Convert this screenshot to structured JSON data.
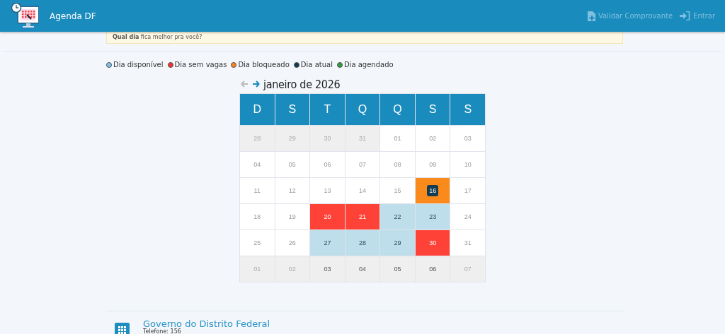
{
  "header": {
    "app_name": "Agenda DF",
    "actions": [
      {
        "label": "Validar Comprovante",
        "kind": "document"
      },
      {
        "label": "Entrar",
        "kind": "login"
      }
    ]
  },
  "notice": {
    "text": "**Qual dia** fica melhor pra você?"
  },
  "legend": [
    {
      "label": "Dia disponível",
      "color": "#7fc3e4"
    },
    {
      "label": "Dia sem vagas",
      "color": "#f0332f"
    },
    {
      "label": "Dia bloqueado",
      "color": "#f7861b"
    },
    {
      "label": "Dia atual",
      "color": "#123c52"
    },
    {
      "label": "Dia agendado",
      "color": "#2e9e3c"
    }
  ],
  "calendar": {
    "title": "janeiro de 2026",
    "prev_disabled": true,
    "next_disabled": false,
    "weekdays": [
      "D",
      "S",
      "T",
      "Q",
      "Q",
      "S",
      "S"
    ],
    "weeks": [
      [
        {
          "day": "28",
          "kind": "outside"
        },
        {
          "day": "29",
          "kind": "outside"
        },
        {
          "day": "30",
          "kind": "outside"
        },
        {
          "day": "31",
          "kind": "outside"
        },
        {
          "day": "01",
          "kind": "normal"
        },
        {
          "day": "02",
          "kind": "normal"
        },
        {
          "day": "03",
          "kind": "normal"
        }
      ],
      [
        {
          "day": "04",
          "kind": "normal"
        },
        {
          "day": "05",
          "kind": "normal"
        },
        {
          "day": "06",
          "kind": "normal"
        },
        {
          "day": "07",
          "kind": "normal"
        },
        {
          "day": "08",
          "kind": "normal"
        },
        {
          "day": "09",
          "kind": "normal"
        },
        {
          "day": "10",
          "kind": "normal"
        }
      ],
      [
        {
          "day": "11",
          "kind": "normal"
        },
        {
          "day": "12",
          "kind": "normal"
        },
        {
          "day": "13",
          "kind": "normal"
        },
        {
          "day": "14",
          "kind": "normal"
        },
        {
          "day": "15",
          "kind": "normal"
        },
        {
          "day": "16",
          "kind": "blocked",
          "today": true
        },
        {
          "day": "17",
          "kind": "normal"
        }
      ],
      [
        {
          "day": "18",
          "kind": "normal"
        },
        {
          "day": "19",
          "kind": "normal"
        },
        {
          "day": "20",
          "kind": "full"
        },
        {
          "day": "21",
          "kind": "full"
        },
        {
          "day": "22",
          "kind": "available"
        },
        {
          "day": "23",
          "kind": "available"
        },
        {
          "day": "24",
          "kind": "normal"
        }
      ],
      [
        {
          "day": "25",
          "kind": "normal"
        },
        {
          "day": "26",
          "kind": "normal"
        },
        {
          "day": "27",
          "kind": "available"
        },
        {
          "day": "28",
          "kind": "available"
        },
        {
          "day": "29",
          "kind": "available"
        },
        {
          "day": "30",
          "kind": "full"
        },
        {
          "day": "31",
          "kind": "normal"
        }
      ],
      [
        {
          "day": "01",
          "kind": "outside"
        },
        {
          "day": "02",
          "kind": "outside"
        },
        {
          "day": "03",
          "kind": "outside_open"
        },
        {
          "day": "04",
          "kind": "outside_open"
        },
        {
          "day": "05",
          "kind": "outside_open"
        },
        {
          "day": "06",
          "kind": "outside_open"
        },
        {
          "day": "07",
          "kind": "outside"
        }
      ]
    ]
  },
  "footer": {
    "title": "Governo do Distrito Federal",
    "phone": "Telefone: 156"
  }
}
